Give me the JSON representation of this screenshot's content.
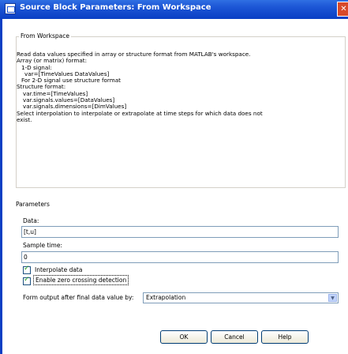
{
  "window": {
    "title": "Source Block Parameters: From Workspace",
    "close_glyph": "✕"
  },
  "block": {
    "name": "From Workspace",
    "description": [
      "Read data values specified in array or structure format from MATLAB's workspace.",
      "Array (or matrix) format:",
      "  1-D signal:",
      "    var=[TimeValues DataValues]",
      "  For 2-D signal use structure format",
      "Structure format:",
      "    var.time=[TimeValues]",
      "    var.signals.values=[DataValues]",
      "    var.signals.dimensions=[DimValues]",
      "Select interpolation to interpolate or extrapolate at time steps for which data does not",
      "exist."
    ]
  },
  "parameters": {
    "title": "Parameters",
    "data_label": "Data:",
    "data_value": "[t,u]",
    "sample_time_label": "Sample time:",
    "sample_time_value": "0",
    "interpolate_label": "Interpolate data",
    "interpolate_checked": true,
    "zero_crossing_label": "Enable zero crossing detection",
    "zero_crossing_checked": true,
    "form_output_label": "Form output after final data value by:",
    "form_output_value": "Extrapolation"
  },
  "buttons": {
    "ok": "OK",
    "cancel": "Cancel",
    "help": "Help"
  },
  "icons": {
    "window_icon": "simulink-block-icon",
    "dropdown": "chevron-down-icon",
    "checkmark": "checkmark-icon"
  },
  "colors": {
    "titlebar": "#0a3fc4",
    "close_button": "#d84a2a",
    "textbox_border": "#7f9db9",
    "check_green": "#21a121"
  }
}
